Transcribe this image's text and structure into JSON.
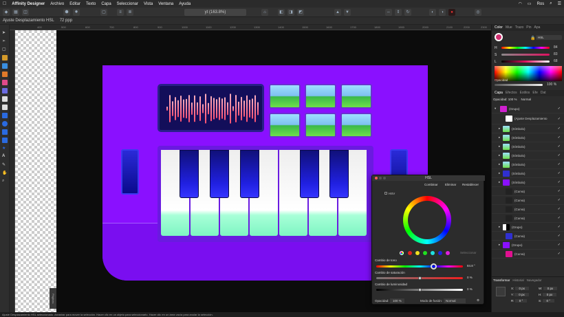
{
  "menubar": {
    "app_name": "Affinity Designer",
    "items": [
      "Archivo",
      "Editar",
      "Texto",
      "Capa",
      "Seleccionar",
      "Vista",
      "Ventana",
      "Ayuda"
    ],
    "user": "Ros"
  },
  "toolbar": {
    "zoom": "yt (163.8%)"
  },
  "context_bar": {
    "label": "Ajuste Desplazamiento HSL",
    "dpi": "72 ppp"
  },
  "ruler": {
    "ticks": [
      "400",
      "500",
      "600",
      "700",
      "800",
      "900",
      "1000",
      "1100",
      "1200",
      "1300",
      "1400",
      "1500",
      "1600",
      "1700",
      "1800",
      "1900",
      "2000",
      "2100",
      "2200",
      "2300"
    ]
  },
  "pages_tab": "Páginas",
  "color_panel": {
    "tabs": [
      "Color",
      "Mue",
      "Trazo",
      "Pin",
      "Apa"
    ],
    "mode": "HSL",
    "h_label": "H",
    "h_value": "84",
    "s_label": "S",
    "s_value": "83",
    "l_label": "L",
    "l_value": "68",
    "opacity_label": "Opacidad",
    "opacity_value": "100 %"
  },
  "layers_panel": {
    "tabs": [
      "Capa",
      "Efectos",
      "Estilos",
      "Efe",
      "Dat"
    ],
    "opacity": "Opacidad: 100 %",
    "blend": "Normal",
    "layers": [
      {
        "name": "(Grupo)"
      },
      {
        "name": "(Ajuste Desplazamiento"
      },
      {
        "name": "(Símbolo)"
      },
      {
        "name": "(Símbolo)"
      },
      {
        "name": "(Símbolo)"
      },
      {
        "name": "(Símbolo)"
      },
      {
        "name": "(Símbolo)"
      },
      {
        "name": "(Símbolo)"
      },
      {
        "name": "(Símbolo)"
      },
      {
        "name": "(Curva)"
      },
      {
        "name": "(Curva)"
      },
      {
        "name": "(Curva)"
      },
      {
        "name": "(Curva)"
      },
      {
        "name": "(Grupo)"
      },
      {
        "name": "(Curva)"
      },
      {
        "name": "(Grupo)"
      },
      {
        "name": "(Curva)"
      }
    ]
  },
  "transform_panel": {
    "tabs": [
      "Transformar",
      "Historial",
      "Navegador"
    ],
    "x_label": "X:",
    "x_value": "0 px",
    "y_label": "Y:",
    "y_value": "0 px",
    "w_label": "W:",
    "w_value": "0 px",
    "h_label": "H:",
    "h_value": "0 px",
    "r_label": "R:",
    "r_value": "0 °",
    "s_label": "S:",
    "s_value": "0 °"
  },
  "hsl_dialog": {
    "title": "HSL",
    "combine": "Combinar",
    "delete": "Eliminar",
    "reset": "Restablecer",
    "hsv_label": "HSV",
    "select_label": "Seleccionar",
    "hue_label": "Cambio de tono",
    "hue_value": "84.8 °",
    "sat_label": "Cambio de saturación",
    "sat_value": "0 %",
    "lum_label": "Cambio de luminosidad",
    "lum_value": "0 %",
    "opacity_label": "Opacidad:",
    "opacity_value": "100 %",
    "blend_label": "Modo de fusión:",
    "blend_value": "Normal",
    "hue_fraction": 0.66,
    "sat_fraction": 0.5,
    "lum_fraction": 0.5
  },
  "status_bar": {
    "text": "Ajuste Desplazamiento HSL seleccionado. Arrastrar para mover la selección. Hacer clic en un objeto para seleccionarlo. Hacer clic en un área vacía para anular la selección."
  }
}
